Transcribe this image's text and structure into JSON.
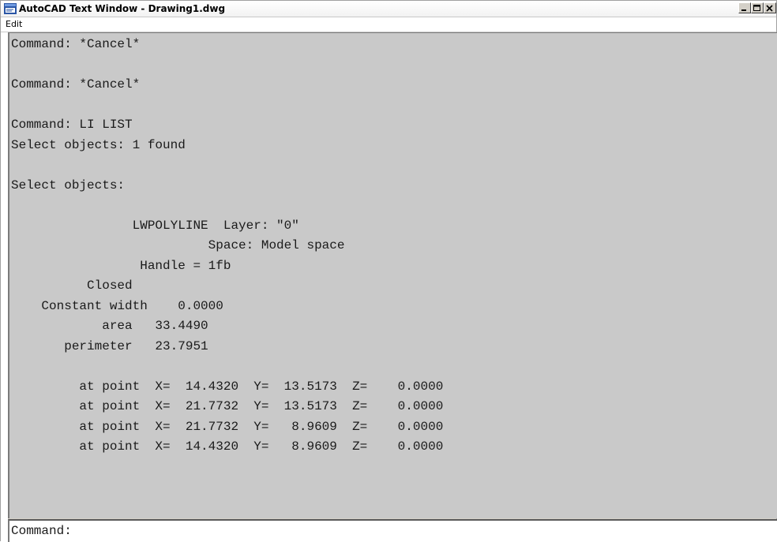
{
  "window": {
    "title": "AutoCAD Text Window - Drawing1.dwg",
    "icon": "autocad-app-icon"
  },
  "caption_buttons": {
    "minimize": "minimize-icon",
    "maximize": "maximize-icon",
    "close": "close-icon"
  },
  "menu": {
    "items": [
      "Edit"
    ]
  },
  "history": {
    "lines": [
      "Command: *Cancel*",
      "",
      "Command: *Cancel*",
      "",
      "Command: LI LIST",
      "Select objects: 1 found",
      "",
      "Select objects:",
      "",
      "                LWPOLYLINE  Layer: \"0\"",
      "                          Space: Model space",
      "                 Handle = 1fb",
      "          Closed",
      "    Constant width    0.0000",
      "            area   33.4490",
      "       perimeter   23.7951",
      "",
      "         at point  X=  14.4320  Y=  13.5173  Z=    0.0000",
      "         at point  X=  21.7732  Y=  13.5173  Z=    0.0000",
      "         at point  X=  21.7732  Y=   8.9609  Z=    0.0000",
      "         at point  X=  14.4320  Y=   8.9609  Z=    0.0000"
    ]
  },
  "command_line": {
    "prompt": "Command:"
  },
  "colors": {
    "history_background": "#c9c9c9",
    "command_line_background": "#ffffff",
    "text": "#1a1a1a"
  }
}
